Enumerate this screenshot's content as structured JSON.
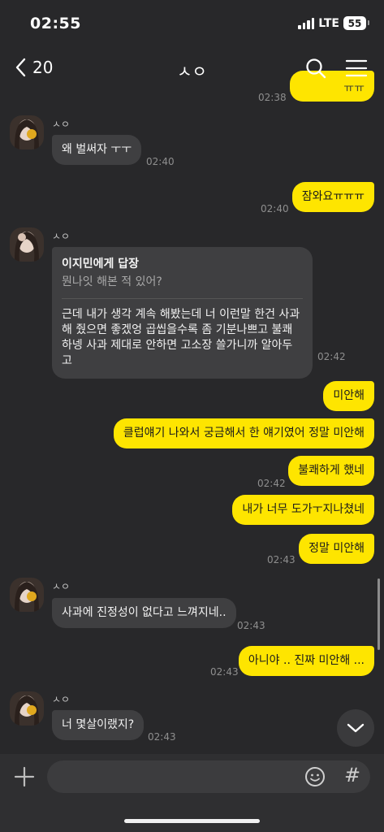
{
  "status_bar": {
    "time": "02:55",
    "network": "LTE",
    "battery": "55"
  },
  "header": {
    "back_count": "20",
    "title": "ㅅㅇ"
  },
  "partial_top": {
    "time": "02:38",
    "bubble_fragment": "ㅠㅠ"
  },
  "messages": [
    {
      "sender": "ㅅㅇ",
      "text": "왜 벌써자 ㅜㅜ",
      "time": "02:40"
    },
    {
      "text": "잠와요ㅠㅠㅠ",
      "time": "02:40"
    },
    {
      "sender": "ㅅㅇ",
      "reply_to": "이지민에게 답장",
      "reply_preview": "뭔나잇 해본 적 있어?",
      "text": "근데 내가 생각 계속 해봤는데 너 이런말 한건 사과해 줬으면 좋겠엉 곱씹을수록 좀 기분나쁘고 불쾌하넹 사과 제대로 안하면 고소장 쓸가니까 알아두고",
      "time": "02:42"
    },
    {
      "text": "미안해"
    },
    {
      "text": "클럽얘기 나와서 궁금해서 한 얘기였어 정말 미안해"
    },
    {
      "text": "불쾌하게 했네",
      "time": "02:42"
    },
    {
      "text": "내가 너무 도가ㅜ지나쳤네"
    },
    {
      "text": "정말 미안해",
      "time": "02:43"
    },
    {
      "sender": "ㅅㅇ",
      "text": "사과에 진정성이 없다고 느껴지네..",
      "time": "02:43"
    },
    {
      "text": "아니야 .. 진짜 미안해 ...",
      "time": "02:43"
    },
    {
      "sender": "ㅅㅇ",
      "text": "너 몇살이랬지?",
      "time": "02:43"
    }
  ],
  "input": {
    "placeholder": "",
    "hash_label": "#"
  },
  "icons": {
    "back": "chevron-left-icon",
    "search": "search-icon",
    "menu": "hamburger-menu-icon",
    "add": "plus-icon",
    "emoji": "smiley-icon",
    "scroll_down": "chevron-down-icon"
  },
  "colors": {
    "background": "#28282a",
    "outgoing": "#fee500",
    "incoming": "#3f3f41"
  }
}
